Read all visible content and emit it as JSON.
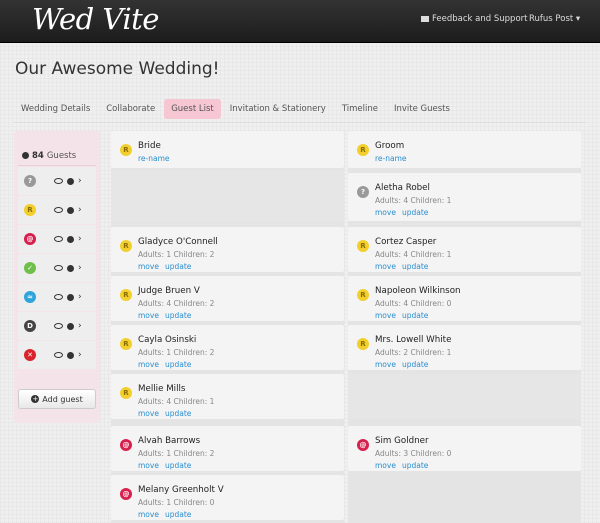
{
  "header": {
    "logo": "Wed Vite",
    "feedback_label": "Feedback and Support",
    "user_label": "Rufus Post ▾"
  },
  "page": {
    "title": "Our Awesome Wedding!"
  },
  "tabs": [
    {
      "label": "Wedding Details",
      "active": false
    },
    {
      "label": "Collaborate",
      "active": false
    },
    {
      "label": "Guest List",
      "active": true
    },
    {
      "label": "Invitation & Stationery",
      "active": false
    },
    {
      "label": "Timeline",
      "active": false
    },
    {
      "label": "Invite Guests",
      "active": false
    }
  ],
  "sidebar": {
    "guest_count": "84",
    "guest_count_label": "Guests",
    "filters": [
      {
        "symbol": "?",
        "status": "unknown"
      },
      {
        "symbol": "R",
        "status": "reserved"
      },
      {
        "symbol": "@",
        "status": "invited"
      },
      {
        "symbol": "✓",
        "status": "accepted"
      },
      {
        "symbol": "≈",
        "status": "pending"
      },
      {
        "symbol": "D",
        "status": "declined-d"
      },
      {
        "symbol": "✕",
        "status": "declined"
      }
    ],
    "add_guest_label": "Add guest"
  },
  "guests_left": [
    {
      "name": "Bride",
      "detail": "",
      "rename": "re-name",
      "badge": "R"
    },
    {
      "name": "Gladyce O'Connell",
      "detail": "Adults: 1 Children: 2",
      "badge": "R"
    },
    {
      "name": "Judge Bruen V",
      "detail": "Adults: 4 Children: 2",
      "badge": "R"
    },
    {
      "name": "Cayla Osinski",
      "detail": "Adults: 1 Children: 2",
      "badge": "R"
    },
    {
      "name": "Mellie Mills",
      "detail": "Adults: 4 Children: 1",
      "badge": "R"
    },
    {
      "name": "Alvah Barrows",
      "detail": "Adults: 1 Children: 2",
      "badge": "@"
    },
    {
      "name": "Melany Greenholt V",
      "detail": "Adults: 1 Children: 0",
      "badge": "@"
    }
  ],
  "guests_right": [
    {
      "name": "Groom",
      "detail": "",
      "rename": "re-name",
      "badge": "R"
    },
    {
      "name": "Aletha Robel",
      "detail": "Adults: 4 Children: 1",
      "badge": "?"
    },
    {
      "name": "Cortez Casper",
      "detail": "Adults: 4 Children: 1",
      "badge": "R"
    },
    {
      "name": "Napoleon Wilkinson",
      "detail": "Adults: 4 Children: 0",
      "badge": "R"
    },
    {
      "name": "Mrs. Lowell White",
      "detail": "Adults: 2 Children: 1",
      "badge": "R"
    },
    {
      "name": "Sim Goldner",
      "detail": "Adults: 3 Children: 0",
      "badge": "@"
    }
  ],
  "card_links": {
    "move": "move",
    "update": "update"
  }
}
